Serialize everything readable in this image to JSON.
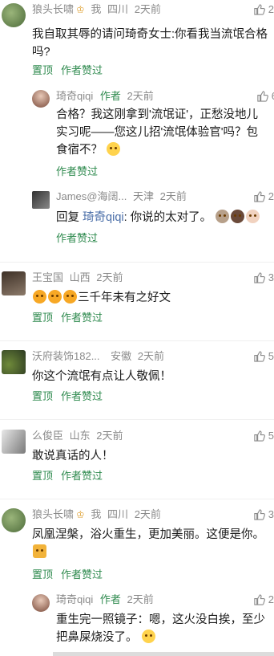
{
  "actions": {
    "pin": "置顶",
    "author_like": "作者赞过"
  },
  "c1": {
    "name": "狼头长啸",
    "badge": "我",
    "loc": "四川",
    "time": "2天前",
    "likes": "2",
    "text": "我自取其辱的请问琦奇女士:你看我当流氓合格吗?"
  },
  "c1r1": {
    "name": "琦奇qiqi",
    "author_tag": "作者",
    "time": "2天前",
    "likes": "6",
    "text": "合格？我这刚拿到'流氓证'，正愁没地儿实习呢——您这儿招'流氓体验官'吗？包食宿不？"
  },
  "c1r2": {
    "name": "James@海阔...",
    "loc": "天津",
    "time": "2天前",
    "likes": "2",
    "prefix": "回复 ",
    "reply_to": "琦奇qiqi",
    "text": ": 你说的太对了。"
  },
  "c2": {
    "name": "王宝国",
    "loc": "山西",
    "time": "2天前",
    "likes": "3",
    "text": "三千年未有之好文"
  },
  "c3": {
    "name": "沃府装饰182...",
    "loc": "安徽",
    "time": "2天前",
    "likes": "5",
    "text": "你这个流氓有点让人敬佩！"
  },
  "c4": {
    "name": "么俊臣",
    "loc": "山东",
    "time": "2天前",
    "likes": "5",
    "text": "敢说真话的人！"
  },
  "c5": {
    "name": "狼头长啸",
    "badge": "我",
    "loc": "四川",
    "time": "2天前",
    "likes": "3",
    "text": "凤凰涅槃，浴火重生，更加美丽。这便是你。"
  },
  "c5r1": {
    "name": "琦奇qiqi",
    "author_tag": "作者",
    "time": "2天前",
    "likes": "2",
    "text": "重生完一照镜子：嗯，这火没白挨，至少把鼻屎烧没了。"
  }
}
